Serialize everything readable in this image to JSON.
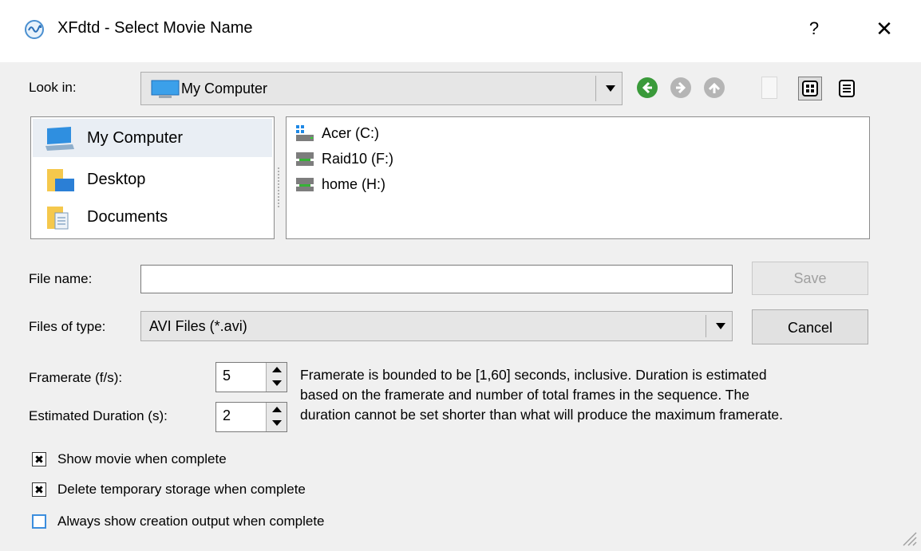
{
  "window": {
    "title": "XFdtd - Select Movie Name",
    "help_label": "?",
    "close_label": "✕"
  },
  "look_in": {
    "label": "Look in:",
    "value": "My Computer"
  },
  "places": [
    {
      "label": "My Computer",
      "icon": "computer-icon"
    },
    {
      "label": "Desktop",
      "icon": "desktop-folder-icon"
    },
    {
      "label": "Documents",
      "icon": "documents-folder-icon"
    }
  ],
  "drives": [
    {
      "label": "Acer (C:)",
      "icon": "windows-drive-icon"
    },
    {
      "label": "Raid10 (F:)",
      "icon": "network-drive-icon"
    },
    {
      "label": "home (H:)",
      "icon": "network-drive-icon"
    }
  ],
  "file_name": {
    "label": "File name:",
    "value": "",
    "placeholder": ""
  },
  "files_of_type": {
    "label": "Files of type:",
    "value": "AVI Files (*.avi)"
  },
  "buttons": {
    "save": "Save",
    "cancel": "Cancel"
  },
  "framerate": {
    "label": "Framerate (f/s):",
    "value": "5"
  },
  "duration": {
    "label": "Estimated Duration (s):",
    "value": "2"
  },
  "info": {
    "line1": "Framerate is bounded to be [1,60] seconds, inclusive. Duration is estimated",
    "line2": "based on the framerate and number of total frames in the sequence.  The",
    "line3": "duration cannot be set shorter than what will produce the maximum framerate."
  },
  "options": [
    {
      "label": "Show movie when complete",
      "checked": true
    },
    {
      "label": "Delete temporary storage when complete",
      "checked": true
    },
    {
      "label": "Always show creation output when complete",
      "checked": false
    }
  ],
  "colors": {
    "back_green": "#3a9a3a",
    "disabled_gray": "#b5b5b5",
    "checkbox_blue": "#3c8ede"
  }
}
